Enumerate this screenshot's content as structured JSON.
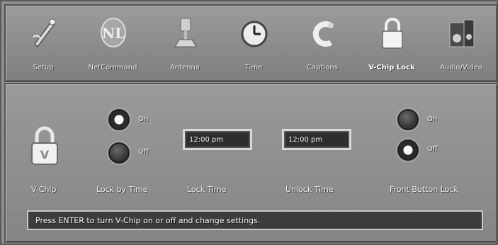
{
  "tabs": [
    {
      "label": "Setup",
      "icon": "setup-wand-icon"
    },
    {
      "label": "NetCommand",
      "icon": "netcommand-icon"
    },
    {
      "label": "Antenna",
      "icon": "antenna-icon"
    },
    {
      "label": "Time",
      "icon": "clock-icon"
    },
    {
      "label": "Captions",
      "icon": "captions-icon"
    },
    {
      "label": "V-Chip Lock",
      "icon": "padlock-icon",
      "active": true
    },
    {
      "label": "Audio/Video",
      "icon": "audio-video-icon"
    }
  ],
  "vchip": {
    "label": "V-Chip",
    "icon": "padlock-v-icon"
  },
  "lock_by_time": {
    "label": "Lock by Time",
    "on_label": "On",
    "off_label": "Off",
    "selected": "On"
  },
  "lock_time": {
    "label": "Lock Time",
    "value": "12:00 pm"
  },
  "unlock_time": {
    "label": "Unlock Time",
    "value": "12:00 pm"
  },
  "front_button_lock": {
    "label": "Front Button Lock",
    "on_label": "On",
    "off_label": "Off",
    "selected": "Off"
  },
  "status_message": "Press ENTER to turn V-Chip on or off and change settings."
}
